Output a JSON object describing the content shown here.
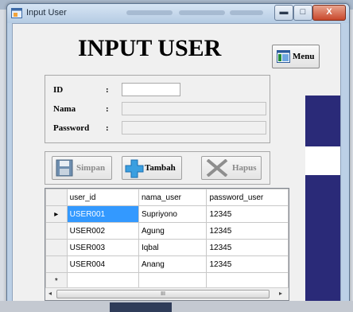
{
  "window": {
    "title": "Input User",
    "minimize_glyph": "▬",
    "maximize_glyph": "□",
    "close_glyph": "X"
  },
  "heading": "INPUT USER",
  "menu": {
    "label": "Menu",
    "icon": "window-icon"
  },
  "form": {
    "fields": [
      {
        "label": "ID",
        "colon": ":",
        "value": ""
      },
      {
        "label": "Nama",
        "colon": ":",
        "value": ""
      },
      {
        "label": "Password",
        "colon": ":",
        "value": ""
      }
    ]
  },
  "actions": {
    "simpan": {
      "label": "Simpan",
      "icon": "save-icon",
      "enabled": false
    },
    "tambah": {
      "label": "Tambah",
      "icon": "plus-icon",
      "enabled": true
    },
    "hapus": {
      "label": "Hapus",
      "icon": "delete-x-icon",
      "enabled": false
    }
  },
  "grid": {
    "columns": [
      "user_id",
      "nama_user",
      "password_user"
    ],
    "rows": [
      [
        "USER001",
        "Supriyono",
        "12345"
      ],
      [
        "USER002",
        "Agung",
        "12345"
      ],
      [
        "USER003",
        "Iqbal",
        "12345"
      ],
      [
        "USER004",
        "Anang",
        "12345"
      ]
    ],
    "current_row_marker": "▸",
    "new_row_marker": "*",
    "scroll_left": "◂",
    "scroll_right": "▸",
    "scroll_grip": "III"
  },
  "colors": {
    "selection": "#3399ff",
    "side_panel": "#2a2a78"
  }
}
